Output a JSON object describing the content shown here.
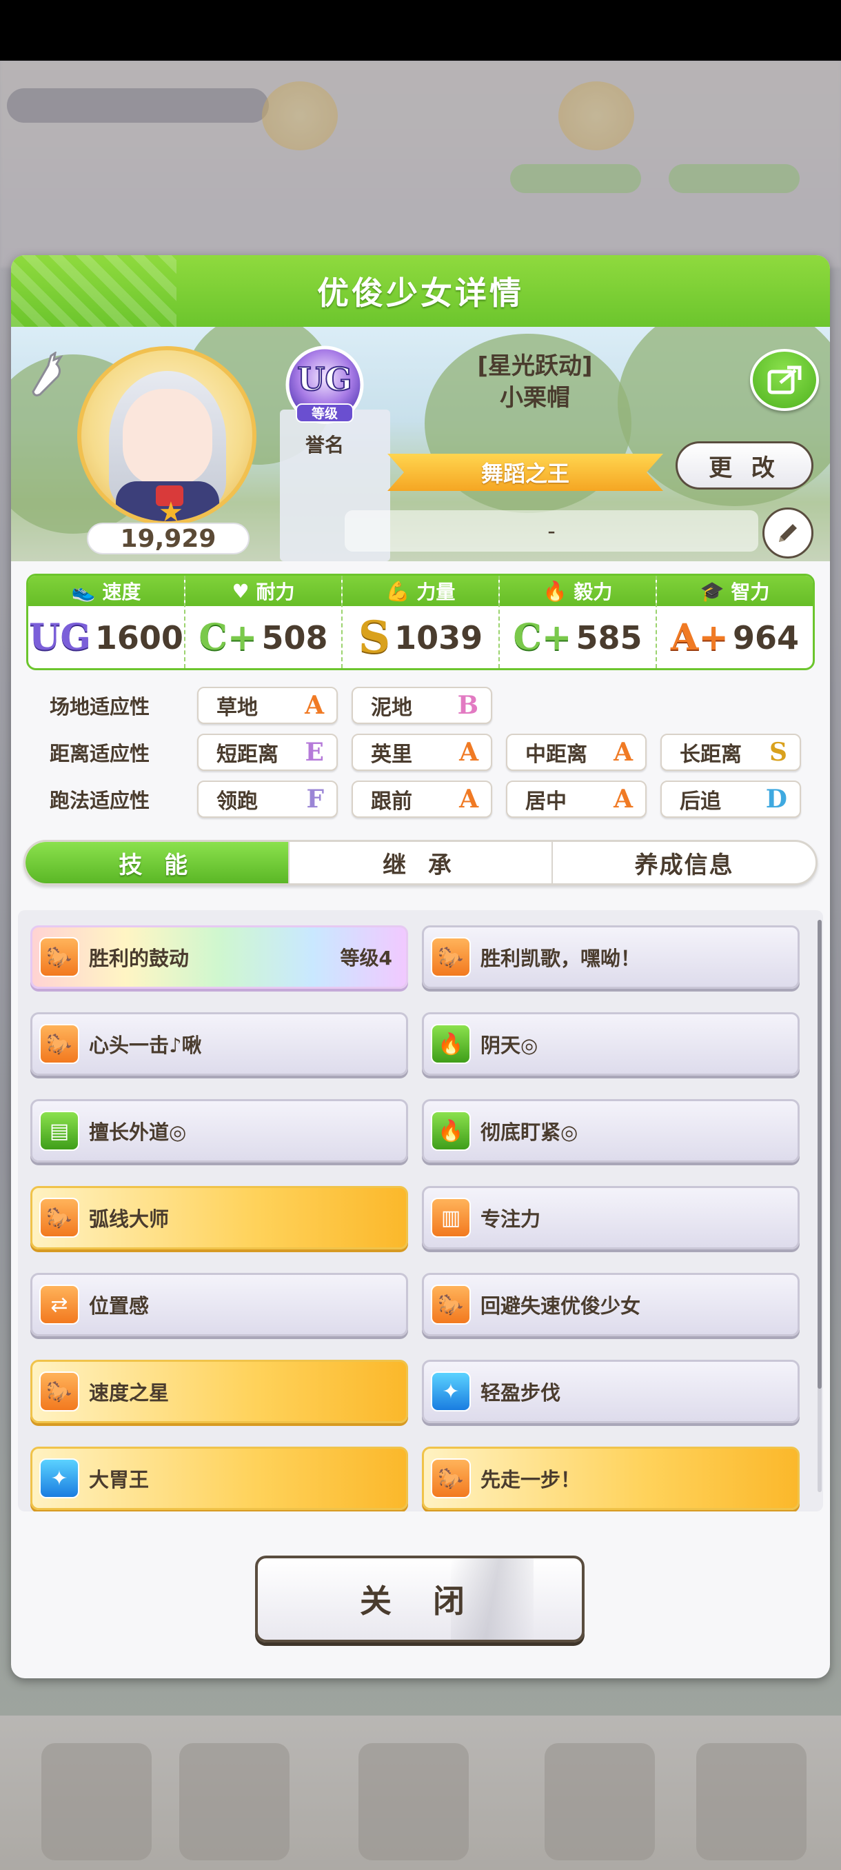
{
  "header": {
    "title": "优俊少女详情"
  },
  "profile": {
    "score": "19,929",
    "rank_badge_text": "UG",
    "rank_badge_sub": "等级",
    "rank_caption": "誉名",
    "outfit": "[星光跃动]",
    "name": "小栗帽",
    "title": "舞蹈之王",
    "change_label": "更 改",
    "motto": "-"
  },
  "stats": [
    {
      "label": "速度",
      "icon": "shoe-icon",
      "grade": "UG",
      "value": "1600"
    },
    {
      "label": "耐力",
      "icon": "heart-icon",
      "grade": "C+",
      "value": "508"
    },
    {
      "label": "力量",
      "icon": "muscle-icon",
      "grade": "S",
      "value": "1039"
    },
    {
      "label": "毅力",
      "icon": "flame-icon",
      "grade": "C+",
      "value": "585"
    },
    {
      "label": "智力",
      "icon": "graduation-cap-icon",
      "grade": "A+",
      "value": "964"
    }
  ],
  "aptitudes": {
    "surface": {
      "label": "场地适应性",
      "items": [
        {
          "name": "草地",
          "grade": "A"
        },
        {
          "name": "泥地",
          "grade": "B"
        }
      ]
    },
    "distance": {
      "label": "距离适应性",
      "items": [
        {
          "name": "短距离",
          "grade": "E"
        },
        {
          "name": "英里",
          "grade": "A"
        },
        {
          "name": "中距离",
          "grade": "A"
        },
        {
          "name": "长距离",
          "grade": "S"
        }
      ]
    },
    "style": {
      "label": "跑法适应性",
      "items": [
        {
          "name": "领跑",
          "grade": "F"
        },
        {
          "name": "跟前",
          "grade": "A"
        },
        {
          "name": "居中",
          "grade": "A"
        },
        {
          "name": "后追",
          "grade": "D"
        }
      ]
    }
  },
  "tabs": {
    "skills": "技 能",
    "inherit": "继 承",
    "training": "养成信息"
  },
  "skills": [
    {
      "name": "胜利的鼓动",
      "level": "等级4",
      "style": "rainbow",
      "icon": "running-horse-icon"
    },
    {
      "name": "胜利凯歌，嘿呦！",
      "level": "",
      "style": "white",
      "icon": "running-horse-icon"
    },
    {
      "name": "心头一击♪啾",
      "level": "",
      "style": "white",
      "icon": "running-horse-icon"
    },
    {
      "name": "阴天◎",
      "level": "",
      "style": "white",
      "icon": "flame-icon"
    },
    {
      "name": "擅长外道◎",
      "level": "",
      "style": "white",
      "icon": "document-icon"
    },
    {
      "name": "彻底盯紧◎",
      "level": "",
      "style": "white",
      "icon": "flame-icon"
    },
    {
      "name": "弧线大师",
      "level": "",
      "style": "gold",
      "icon": "running-horse-icon"
    },
    {
      "name": "专注力",
      "level": "",
      "style": "white",
      "icon": "gate-icon"
    },
    {
      "name": "位置感",
      "level": "",
      "style": "white",
      "icon": "track-icon"
    },
    {
      "name": "回避失速优俊少女",
      "level": "",
      "style": "white",
      "icon": "running-horse-icon"
    },
    {
      "name": "速度之星",
      "level": "",
      "style": "gold",
      "icon": "running-horse-icon"
    },
    {
      "name": "轻盈步伐",
      "level": "",
      "style": "white",
      "icon": "sparkle-icon"
    },
    {
      "name": "大胃王",
      "level": "",
      "style": "gold",
      "icon": "sparkle-icon"
    },
    {
      "name": "先走一步！",
      "level": "",
      "style": "gold",
      "icon": "running-horse-icon"
    }
  ],
  "close_label": "关 闭"
}
